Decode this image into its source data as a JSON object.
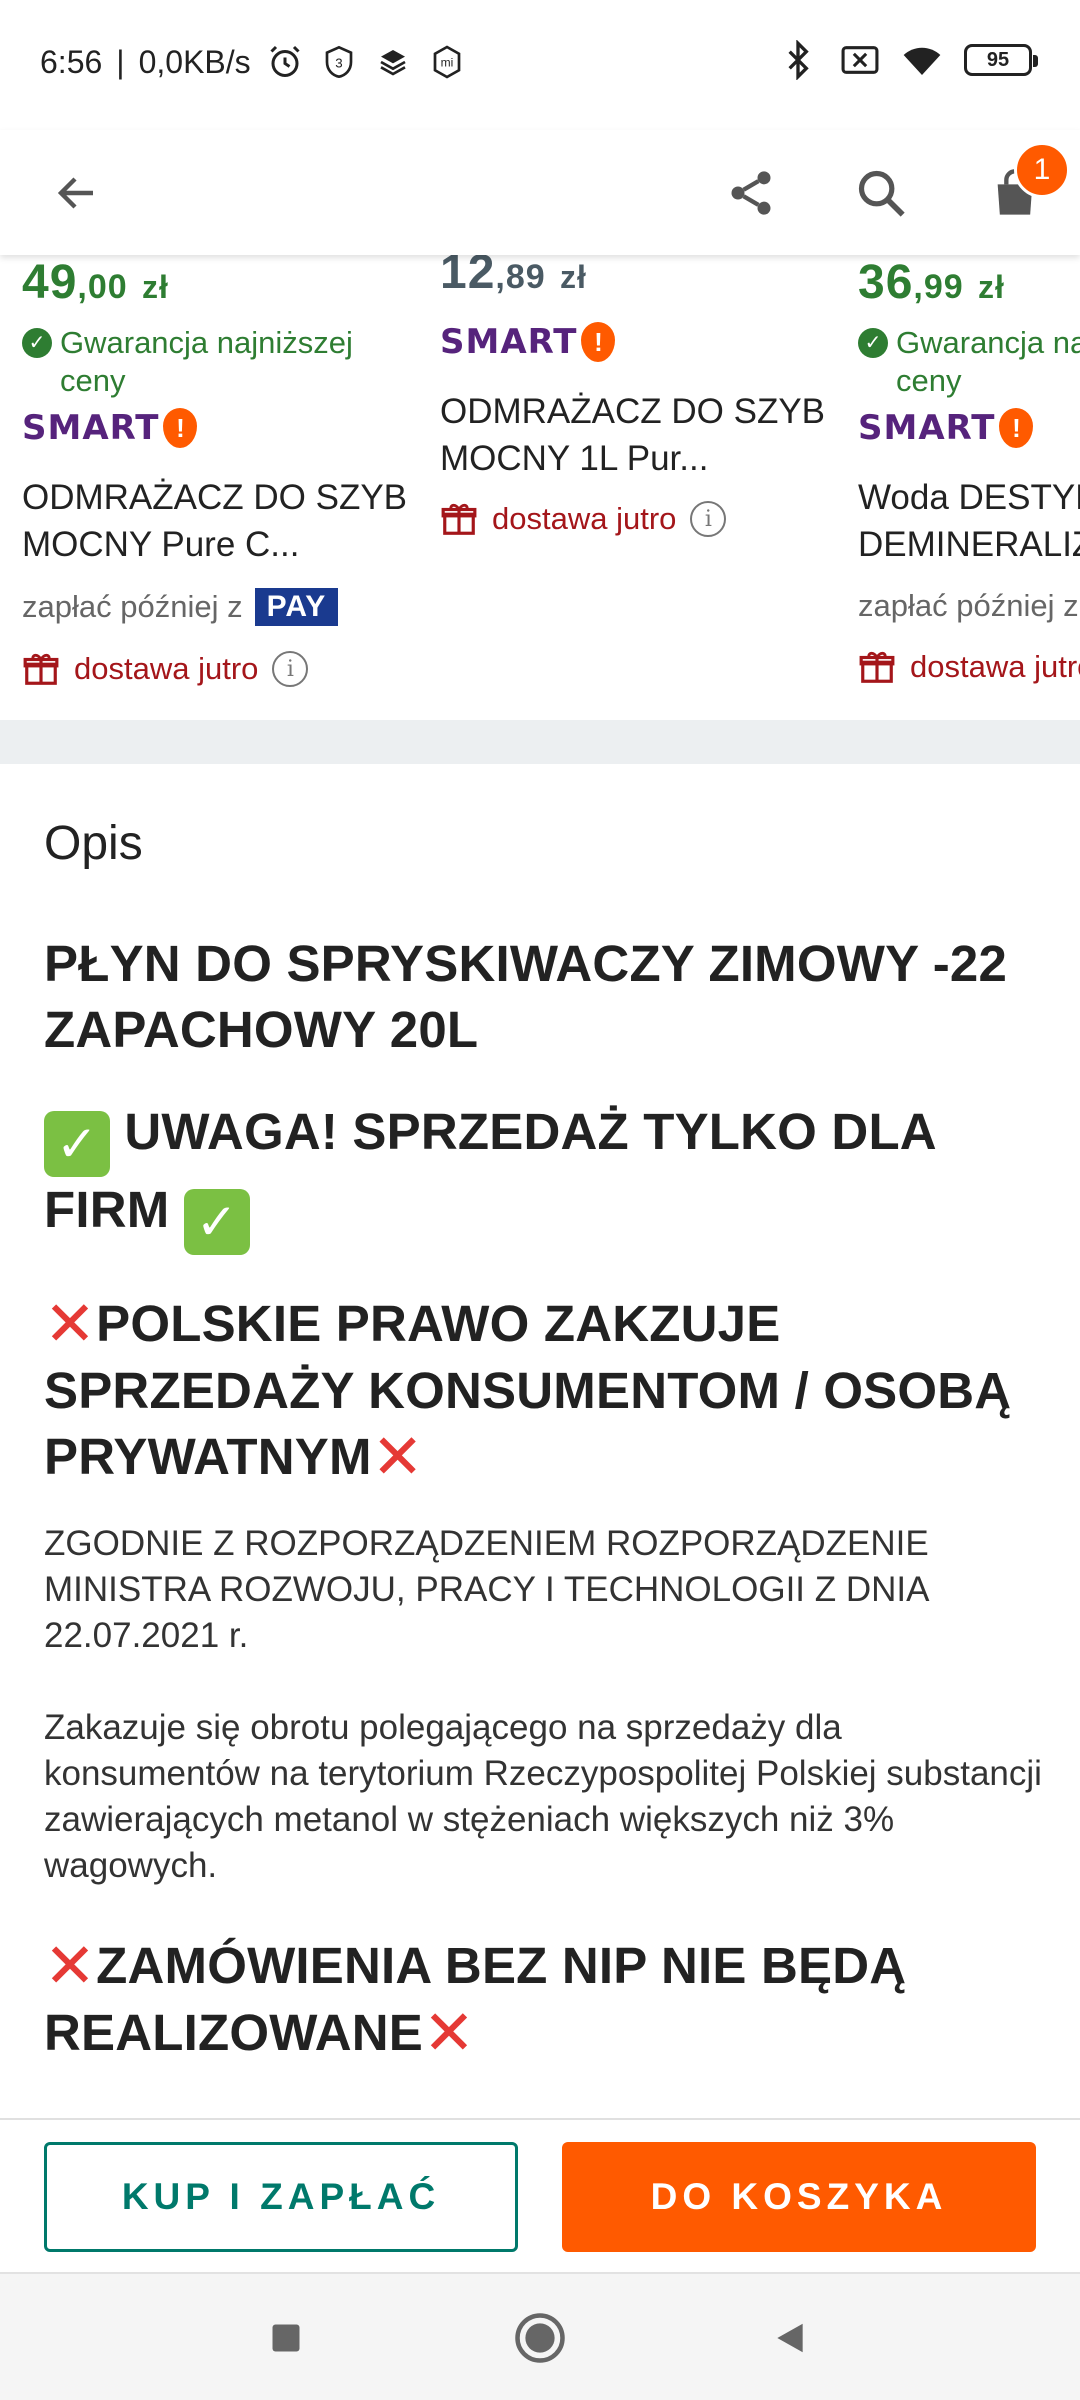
{
  "status_bar": {
    "time": "6:56",
    "network_speed": "0,0KB/s",
    "battery": "95"
  },
  "toolbar": {
    "cart_count": "1"
  },
  "products": [
    {
      "price_int": "49",
      "price_dec": ",00",
      "currency": "zł",
      "guarantee": "Gwarancja najniższej ceny",
      "smart_label": "SMART",
      "name": "ODMRAŻACZ DO SZYB MOCNY Pure C...",
      "pay_later": "zapłać później z",
      "pay_badge": "PAY",
      "delivery": "dostawa jutro"
    },
    {
      "price_int": "12",
      "price_dec": ",89",
      "currency": "zł",
      "smart_label": "SMART",
      "name": "ODMRAŻACZ DO SZYB MOCNY 1L Pur...",
      "delivery": "dostawa jutro"
    },
    {
      "price_int": "36",
      "price_dec": ",99",
      "currency": "zł",
      "guarantee": "Gwarancja najniższej ceny",
      "smart_label": "SMART",
      "name": "Woda DESTYLOWANA DEMINERALIZOWANA",
      "pay_later": "zapłać później z",
      "delivery": "dostawa jutro"
    }
  ],
  "description": {
    "section_title": "Opis",
    "headline": "PŁYN DO SPRYSKIWACZY ZIMOWY -22 ZAPACHOWY 20L",
    "warning_business": "UWAGA! SPRZEDAŻ TYLKO DLA FIRM",
    "warning_law": "POLSKIE PRAWO ZAKZUJE SPRZEDAŻY KONSUMENTOM / OSOBĄ PRYWATNYM",
    "regulation": "ZGODNIE Z ROZPORZĄDZENIEM ROZPORZĄDZENIE MINISTRA ROZWOJU, PRACY I TECHNOLOGII Z DNIA 22.07.2021 r.",
    "ban_text": "Zakazuje się obrotu polegającego na sprzedaży dla konsumentów na terytorium Rzeczypospolitej Polskiej substancji zawierających metanol w stężeniach większych niż 3% wagowych.",
    "nip_warning": "ZAMÓWIENIA BEZ NIP NIE BĘDĄ REALIZOWANE"
  },
  "actions": {
    "buy_label": "KUP I ZAPŁAĆ",
    "cart_label": "DO KOSZYKA"
  },
  "colors": {
    "accent_orange": "#ff5a00",
    "price_green": "#2e7d32",
    "teal": "#00796b",
    "smart_purple": "#56237c",
    "delivery_red": "#a4161a"
  }
}
